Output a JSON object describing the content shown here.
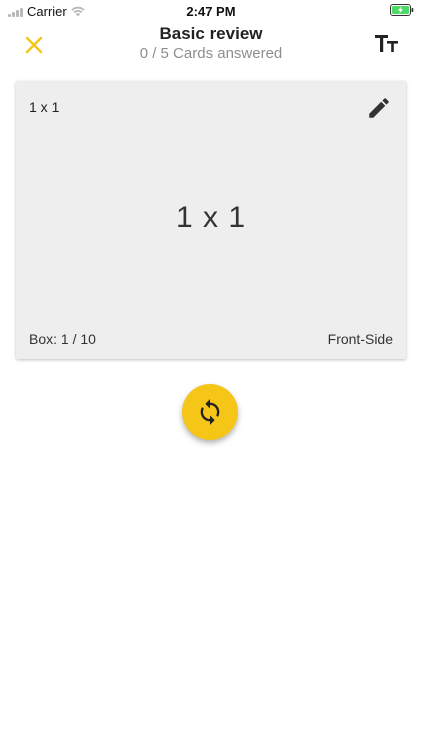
{
  "status_bar": {
    "carrier": "Carrier",
    "time": "2:47 PM",
    "battery_color": "#4cd964"
  },
  "nav": {
    "title": "Basic review",
    "subtitle": "0 / 5 Cards answered",
    "close_icon": "close-icon",
    "textsize_icon": "text-size-icon",
    "accent_color": "#f5c518"
  },
  "card": {
    "corner_question": "1 x 1",
    "question": "1 x 1",
    "box_label": "Box: 1 / 10",
    "side_label": "Front-Side",
    "edit_icon": "pencil-icon",
    "background": "#eeeeee"
  },
  "flip_button": {
    "icon": "sync-icon",
    "color": "#f5c518"
  }
}
